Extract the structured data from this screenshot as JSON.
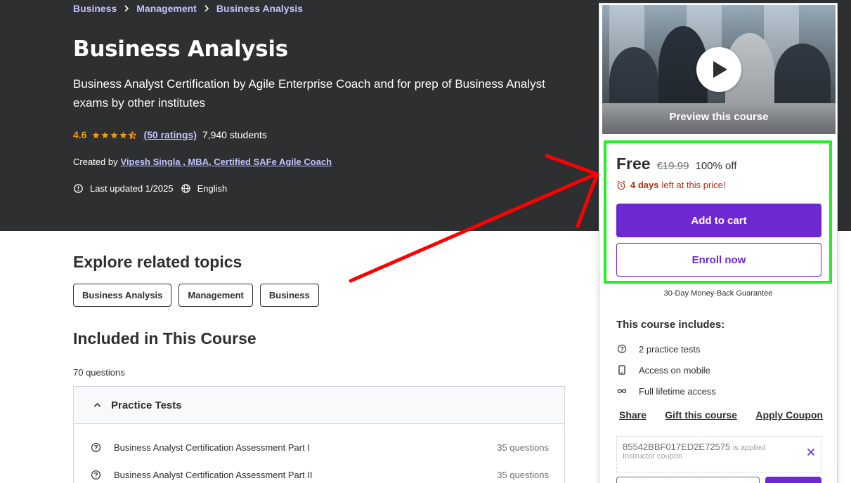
{
  "breadcrumb": [
    "Business",
    "Management",
    "Business Analysis"
  ],
  "course": {
    "title": "Business Analysis",
    "subtitle": "Business Analyst Certification by Agile Enterprise Coach and for prep of Business Analyst exams by other institutes",
    "rating": "4.6",
    "rating_stars": 4.5,
    "ratings_count": "(50 ratings)",
    "students": "7,940 students",
    "created_by_label": "Created by",
    "author": "Vipesh Singla , MBA, Certified SAFe Agile Coach",
    "last_updated": "Last updated 1/2025",
    "language": "English"
  },
  "card": {
    "preview_label": "Preview this course",
    "price_now": "Free",
    "price_old": "€19.99",
    "discount": "100% off",
    "timer_bold": "4 days",
    "timer_rest": "left at this price!",
    "add_to_cart": "Add to cart",
    "enroll_now": "Enroll now",
    "guarantee": "30-Day Money-Back Guarantee",
    "includes_title": "This course includes:",
    "includes": [
      {
        "icon": "question-icon",
        "label": "2 practice tests"
      },
      {
        "icon": "mobile-icon",
        "label": "Access on mobile"
      },
      {
        "icon": "infinity-icon",
        "label": "Full lifetime access"
      }
    ],
    "links": [
      "Share",
      "Gift this course",
      "Apply Coupon"
    ],
    "coupon_code": "85542BBF017ED2E72575",
    "coupon_applied": "is applied",
    "coupon_type": "Instructor coupon"
  },
  "related": {
    "title": "Explore related topics",
    "topics": [
      "Business Analysis",
      "Management",
      "Business"
    ]
  },
  "included": {
    "title": "Included in This Course",
    "question_count": "70 questions",
    "section_label": "Practice Tests",
    "items": [
      {
        "name": "Business Analyst Certification Assessment Part I",
        "questions": "35 questions"
      },
      {
        "name": "Business Analyst Certification Assessment Part II",
        "questions": "35 questions"
      }
    ]
  },
  "colors": {
    "hero_bg": "#2d2f31",
    "accent_purple": "#6d28d2",
    "link_lavender": "#c0c4fc",
    "rating_orange": "#f69c08",
    "timer_red": "#b32d0f",
    "annotation_green": "#22ee22",
    "annotation_red": "#ff0000"
  }
}
